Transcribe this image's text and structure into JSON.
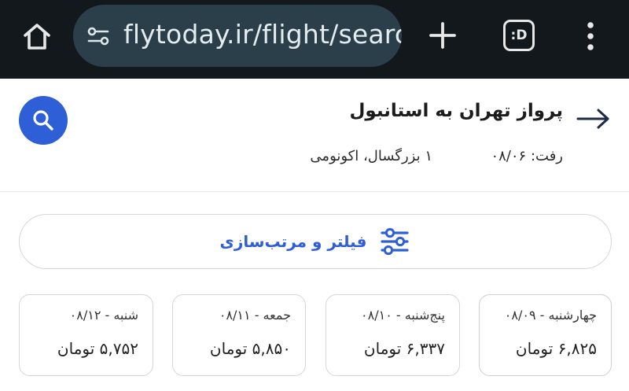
{
  "browser": {
    "url": "flytoday.ir/flight/searcl",
    "tabs_label": ":D"
  },
  "header": {
    "route_title": "پرواز تهران به استانبول",
    "depart_label": "رفت: ۰۸/۰۶",
    "passengers": "۱ بزرگسال، اکونومی"
  },
  "filter": {
    "label": "فیلتر و مرتب‌سازی"
  },
  "dates": [
    {
      "day": "چهارشنبه - ۰۸/۰۹",
      "price": "۶,۸۲۵ تومان"
    },
    {
      "day": "پنج‌شنبه - ۰۸/۱۰",
      "price": "۶,۳۳۷ تومان"
    },
    {
      "day": "جمعه - ۰۸/۱۱",
      "price": "۵,۸۵۰ تومان"
    },
    {
      "day": "شنبه - ۰۸/۱۲",
      "price": "۵,۷۵۲ تومان"
    }
  ],
  "colors": {
    "accent": "#2f5fd6",
    "browser_bg": "#12181c",
    "url_pill": "#2b3f4a"
  },
  "icons": [
    "home-icon",
    "site-settings-icon",
    "plus-icon",
    "tabs-icon",
    "more-vert-icon",
    "back-arrow-icon",
    "search-icon",
    "filter-sliders-icon"
  ]
}
